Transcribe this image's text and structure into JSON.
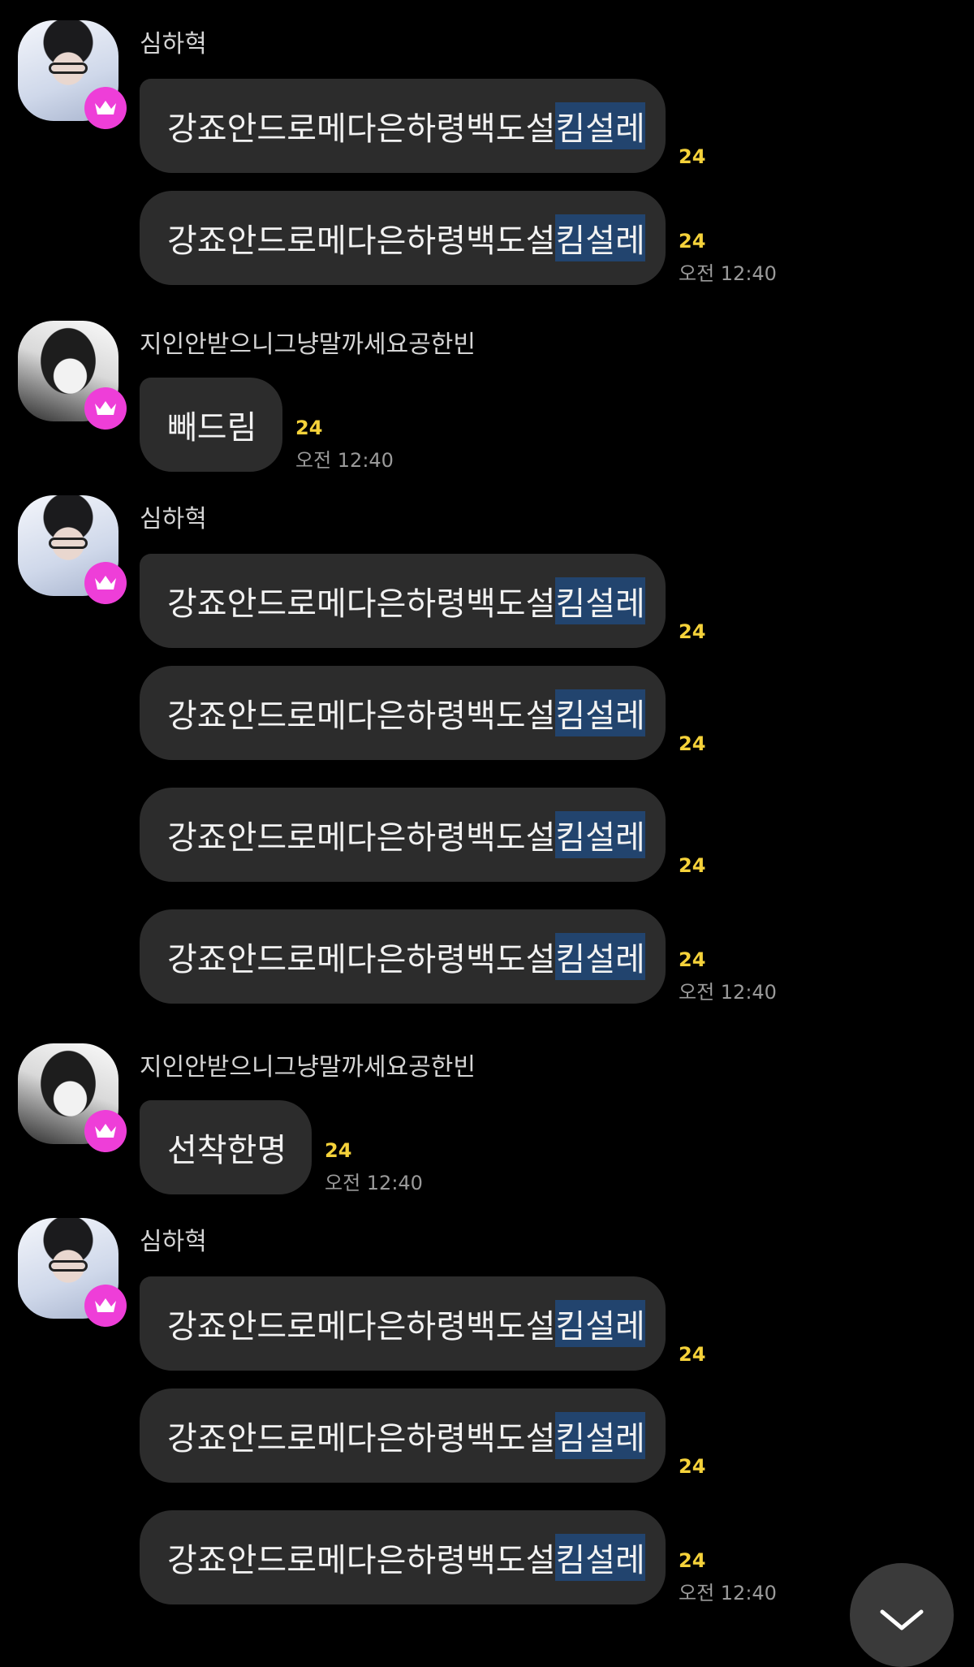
{
  "colors": {
    "background": "#000000",
    "bubble": "#2c2c2c",
    "highlight": "#22446e",
    "unread_count": "#f5d23a",
    "crown_badge": "#ee3ed8"
  },
  "groups": [
    {
      "sender": "심하혁",
      "avatar": "profile-photo-shim",
      "messages": [
        {
          "prefix": "강죠안드로메다은하령백도설",
          "highlight": "킴설레",
          "count": "24",
          "time": ""
        },
        {
          "prefix": "강죠안드로메다은하령백도설",
          "highlight": "킴설레",
          "count": "24",
          "time": "오전 12:40"
        }
      ]
    },
    {
      "sender": "지인안받으니그냥말까세요공한빈",
      "avatar": "profile-photo-kong",
      "messages": [
        {
          "text": "빼드림",
          "count": "24",
          "time": "오전 12:40"
        }
      ]
    },
    {
      "sender": "심하혁",
      "avatar": "profile-photo-shim",
      "messages": [
        {
          "prefix": "강죠안드로메다은하령백도설",
          "highlight": "킴설레",
          "count": "24",
          "time": ""
        },
        {
          "prefix": "강죠안드로메다은하령백도설",
          "highlight": "킴설레",
          "count": "24",
          "time": ""
        },
        {
          "prefix": "강죠안드로메다은하령백도설",
          "highlight": "킴설레",
          "count": "24",
          "time": ""
        },
        {
          "prefix": "강죠안드로메다은하령백도설",
          "highlight": "킴설레",
          "count": "24",
          "time": "오전 12:40"
        }
      ]
    },
    {
      "sender": "지인안받으니그냥말까세요공한빈",
      "avatar": "profile-photo-kong",
      "messages": [
        {
          "text": "선착한명",
          "count": "24",
          "time": "오전 12:40"
        }
      ]
    },
    {
      "sender": "심하혁",
      "avatar": "profile-photo-shim",
      "messages": [
        {
          "prefix": "강죠안드로메다은하령백도설",
          "highlight": "킴설레",
          "count": "24",
          "time": ""
        },
        {
          "prefix": "강죠안드로메다은하령백도설",
          "highlight": "킴설레",
          "count": "24",
          "time": ""
        },
        {
          "prefix": "강죠안드로메다은하령백도설",
          "highlight": "킴설레",
          "count": "24",
          "time": "오전 12:40"
        }
      ]
    }
  ],
  "icons": {
    "badge": "crown-icon",
    "scroll_down": "chevron-down-icon"
  }
}
